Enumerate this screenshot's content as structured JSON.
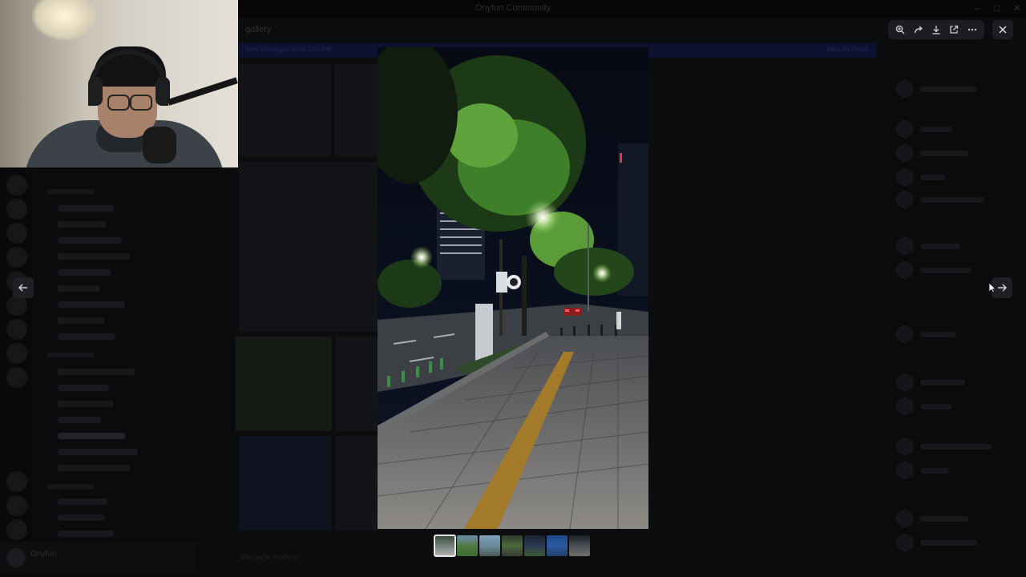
{
  "window": {
    "title": "Onyfun Community",
    "controls": [
      "–",
      "□",
      "✕"
    ]
  },
  "background": {
    "channel_title": "gallery",
    "banner_text": "New messages since 2:58 PM",
    "banner_action": "Mark As Read",
    "user_name": "Onyfun",
    "input_placeholder": "Message #gallery"
  },
  "toolbar": {
    "zoom_label": "Zoom",
    "forward_label": "Forward",
    "download_label": "Download",
    "open_label": "Open in browser",
    "more_label": "More"
  },
  "viewer": {
    "close_label": "Close",
    "prev_label": "Previous",
    "next_label": "Next",
    "image_alt": "Night street with trees and sidewalk",
    "thumbnail_count": 7,
    "active_thumbnail": 0
  },
  "colors": {
    "overlay": "#050506",
    "toolbar_bg": "#1c1d21",
    "icon": "#c9ccd1",
    "accent_banner": "#0d1230"
  },
  "icons": {
    "zoom": "zoom-in-icon",
    "forward": "forward-arrow-icon",
    "download": "download-icon",
    "open": "external-link-icon",
    "more": "ellipsis-icon",
    "close": "close-icon",
    "prev": "arrow-left-icon",
    "next": "arrow-right-icon"
  }
}
